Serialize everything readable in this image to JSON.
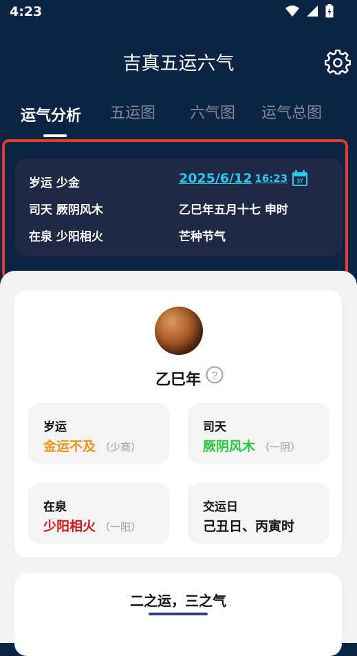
{
  "status_bar": {
    "time": "4:23"
  },
  "header": {
    "title": "吉真五运六气"
  },
  "tabs": [
    {
      "label": "运气分析",
      "active": true
    },
    {
      "label": "五运图",
      "active": false
    },
    {
      "label": "六气图",
      "active": false
    },
    {
      "label": "运气总图",
      "active": false
    }
  ],
  "summary": {
    "suiyun": "岁运 少金",
    "sitian": "司天 厥阴风木",
    "zaiquan": "在泉 少阳相火",
    "date": "2025/6/12",
    "time": "16:23",
    "calendar_icon_day": "37",
    "lunar": "乙巳年五月十七 申时",
    "solar_term": "芒种节气"
  },
  "year_card": {
    "title": "乙巳年",
    "help_symbol": "?",
    "tiles": {
      "suiyun": {
        "label": "岁运",
        "value": "金运不及",
        "sub": "（少商）",
        "color": "#ef9412"
      },
      "sitian": {
        "label": "司天",
        "value": "厥阴风木",
        "sub": "（一阴）",
        "color": "#22c93b"
      },
      "zaiquan": {
        "label": "在泉",
        "value": "少阳相火",
        "sub": "（一阳）",
        "color": "#d21818"
      },
      "jiaoyun": {
        "label": "交运日",
        "value": "己丑日、丙寅时",
        "color": "#111111"
      }
    }
  },
  "bottom_card": {
    "title": "二之运，三之气"
  },
  "colors": {
    "background": "#0b2444",
    "highlight": "#e53b2c",
    "link": "#29c6ee"
  },
  "icons": [
    "wifi-icon",
    "signal-icon",
    "battery-icon",
    "gear-icon",
    "calendar-icon",
    "planet-image",
    "help-icon"
  ]
}
